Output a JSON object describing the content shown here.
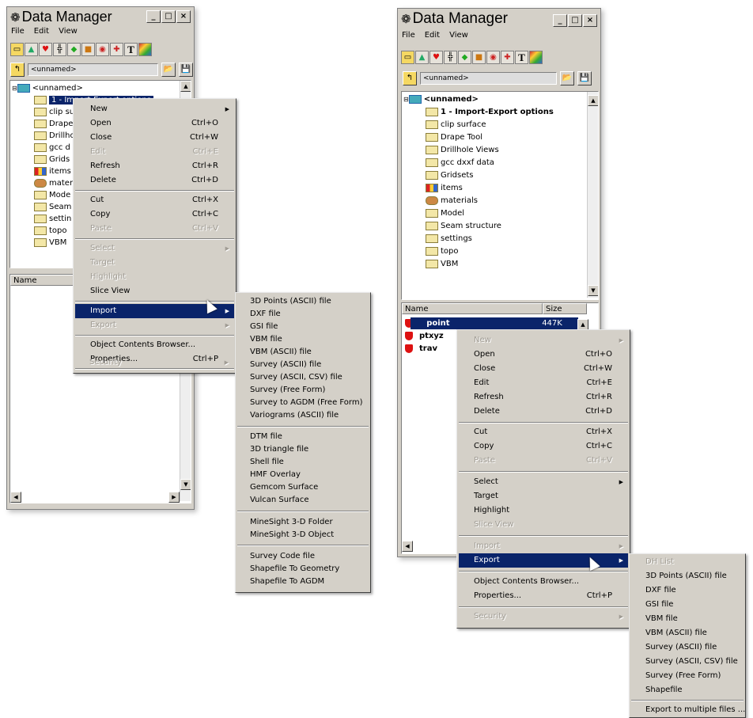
{
  "app": {
    "title": "Data Manager",
    "menus": [
      "File",
      "Edit",
      "View"
    ],
    "window_buttons": [
      "_",
      "□",
      "×"
    ],
    "toolbar_icons": [
      "folder-icon",
      "mountain-icon",
      "heart-icon",
      "grid-icon",
      "diamond-icon",
      "box-icon",
      "target-icon",
      "cross-icon",
      "text-icon",
      "palette-icon"
    ],
    "toolbar_text": "T",
    "address": "<unnamed>"
  },
  "left": {
    "root": "<unnamed>",
    "tree_items": [
      "1 - Import-Export options",
      "clip su",
      "Drape",
      "Drillho",
      "gcc d",
      "Grids",
      "items",
      "mater",
      "Mode",
      "Seam",
      "settin",
      "topo",
      "VBM"
    ],
    "list_header": "Name",
    "context_menu": [
      {
        "label": "New",
        "shortcut": "",
        "arrow": true,
        "disabled": false
      },
      {
        "label": "Open",
        "shortcut": "Ctrl+O",
        "disabled": false
      },
      {
        "label": "Close",
        "shortcut": "Ctrl+W",
        "disabled": false
      },
      {
        "label": "Edit",
        "shortcut": "Ctrl+E",
        "disabled": true
      },
      {
        "label": "Refresh",
        "shortcut": "Ctrl+R",
        "disabled": false
      },
      {
        "label": "Delete",
        "shortcut": "Ctrl+D",
        "disabled": false
      },
      {
        "label": "Cut",
        "shortcut": "Ctrl+X",
        "disabled": false
      },
      {
        "label": "Copy",
        "shortcut": "Ctrl+C",
        "disabled": false
      },
      {
        "label": "Paste",
        "shortcut": "Ctrl+V",
        "disabled": true
      },
      {
        "label": "Select",
        "shortcut": "",
        "arrow": true,
        "disabled": true
      },
      {
        "label": "Target",
        "shortcut": "",
        "disabled": true
      },
      {
        "label": "Highlight",
        "shortcut": "",
        "disabled": true
      },
      {
        "label": "Slice View",
        "shortcut": "",
        "disabled": false
      },
      {
        "label": "Import",
        "shortcut": "",
        "arrow": true,
        "disabled": false,
        "highlighted": true
      },
      {
        "label": "Export",
        "shortcut": "",
        "arrow": true,
        "disabled": true
      },
      {
        "label": "Object Contents Browser...",
        "shortcut": "",
        "disabled": false
      },
      {
        "label": "Properties...",
        "shortcut": "Ctrl+P",
        "disabled": false
      },
      {
        "label": "Security",
        "shortcut": "",
        "arrow": true,
        "disabled": true
      }
    ],
    "import_submenu": [
      "3D Points (ASCII) file",
      "DXF file",
      "GSI file",
      "VBM file",
      "VBM (ASCII) file",
      "Survey (ASCII) file",
      "Survey (ASCII, CSV) file",
      "Survey (Free Form)",
      "Survey to AGDM (Free Form)",
      "Variograms (ASCII) file",
      "DTM file",
      "3D triangle file",
      "Shell file",
      "HMF Overlay",
      "Gemcom Surface",
      "Vulcan Surface",
      "MineSight 3-D Folder",
      "MineSight 3-D Object",
      "Survey Code file",
      "Shapefile To Geometry",
      "Shapefile To AGDM"
    ]
  },
  "right": {
    "root": "<unnamed>",
    "tree_items": [
      "1 - Import-Export options",
      "clip surface",
      "Drape Tool",
      "Drillhole Views",
      "gcc dxxf data",
      "Gridsets",
      "items",
      "materials",
      "Model",
      "Seam structure",
      "settings",
      "topo",
      "VBM"
    ],
    "list_headers": [
      "Name",
      "Size"
    ],
    "list_rows": [
      {
        "name": "point",
        "size": "447K"
      },
      {
        "name": "ptxyz",
        "size": ""
      },
      {
        "name": "trav",
        "size": ""
      }
    ],
    "context_menu": [
      {
        "label": "New",
        "shortcut": "",
        "arrow": true,
        "disabled": true
      },
      {
        "label": "Open",
        "shortcut": "Ctrl+O",
        "disabled": false
      },
      {
        "label": "Close",
        "shortcut": "Ctrl+W",
        "disabled": false
      },
      {
        "label": "Edit",
        "shortcut": "Ctrl+E",
        "disabled": false
      },
      {
        "label": "Refresh",
        "shortcut": "Ctrl+R",
        "disabled": false
      },
      {
        "label": "Delete",
        "shortcut": "Ctrl+D",
        "disabled": false
      },
      {
        "label": "Cut",
        "shortcut": "Ctrl+X",
        "disabled": false
      },
      {
        "label": "Copy",
        "shortcut": "Ctrl+C",
        "disabled": false
      },
      {
        "label": "Paste",
        "shortcut": "Ctrl+V",
        "disabled": true
      },
      {
        "label": "Select",
        "shortcut": "",
        "arrow": true,
        "disabled": false
      },
      {
        "label": "Target",
        "shortcut": "",
        "disabled": false
      },
      {
        "label": "Highlight",
        "shortcut": "",
        "disabled": false
      },
      {
        "label": "Slice View",
        "shortcut": "",
        "disabled": true
      },
      {
        "label": "Import",
        "shortcut": "",
        "arrow": true,
        "disabled": true
      },
      {
        "label": "Export",
        "shortcut": "",
        "arrow": true,
        "disabled": false,
        "highlighted": true
      },
      {
        "label": "Object Contents Browser...",
        "shortcut": "",
        "disabled": false
      },
      {
        "label": "Properties...",
        "shortcut": "Ctrl+P",
        "disabled": false
      },
      {
        "label": "Security",
        "shortcut": "",
        "arrow": true,
        "disabled": true
      }
    ],
    "export_submenu": [
      {
        "label": "DH List",
        "disabled": true
      },
      {
        "label": "3D Points (ASCII) file",
        "disabled": false
      },
      {
        "label": "DXF file",
        "disabled": false
      },
      {
        "label": "GSI file",
        "disabled": false
      },
      {
        "label": "VBM file",
        "disabled": false
      },
      {
        "label": "VBM (ASCII) file",
        "disabled": false
      },
      {
        "label": "Survey (ASCII) file",
        "disabled": false
      },
      {
        "label": "Survey (ASCII, CSV) file",
        "disabled": false
      },
      {
        "label": "Survey (Free Form)",
        "disabled": false
      },
      {
        "label": "Shapefile",
        "disabled": false
      },
      {
        "label": "Export to multiple files ...",
        "disabled": false
      }
    ]
  }
}
